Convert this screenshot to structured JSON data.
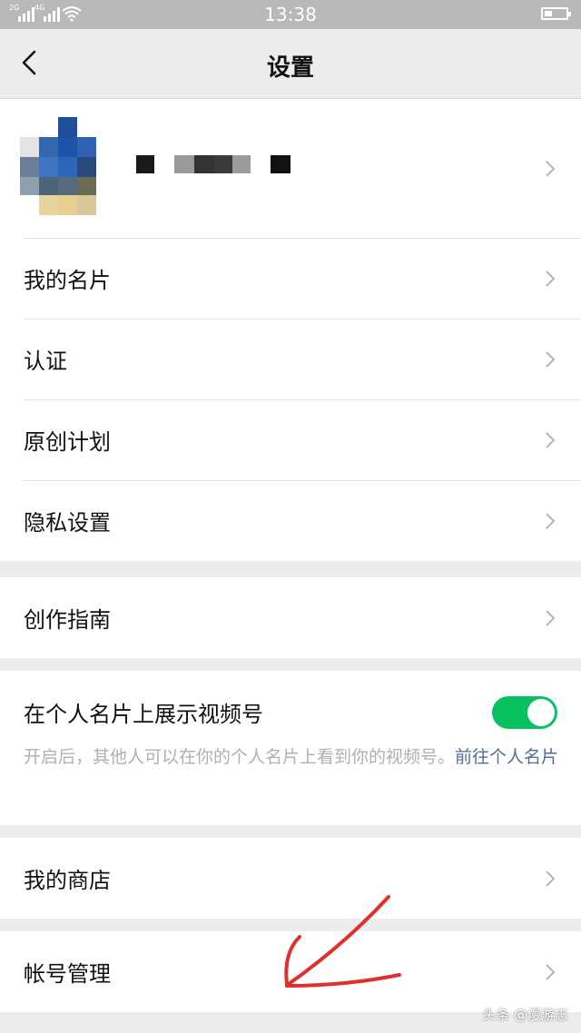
{
  "status_bar": {
    "time": "13:38",
    "signal1_label": "2G",
    "signal2_label": "4G"
  },
  "nav": {
    "title": "设置"
  },
  "menu": {
    "my_card": "我的名片",
    "verification": "认证",
    "original_plan": "原创计划",
    "privacy": "隐私设置",
    "creation_guide": "创作指南",
    "show_channel": "在个人名片上展示视频号",
    "show_channel_desc": "开启后，其他人可以在你的个人名片上看到你的视频号。",
    "show_channel_link": "前往个人名片",
    "my_store": "我的商店",
    "account_manage": "帐号管理"
  },
  "toggle_on": true,
  "colors": {
    "accent_green": "#07c160",
    "link_blue": "#576b95",
    "annotation_red": "#e0302e"
  },
  "watermark": "头条 @漫游志"
}
